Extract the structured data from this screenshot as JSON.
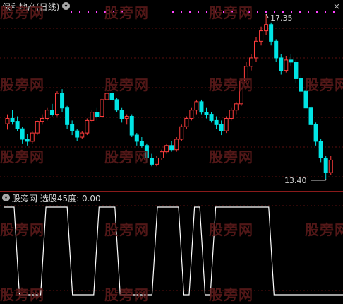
{
  "top": {
    "title": "保利地产(日线)",
    "high_label": "17.35",
    "low_label": "13.40",
    "close_symbol": "×"
  },
  "bottom": {
    "title": "股旁网  选股45度: 0.00"
  },
  "watermark": "股旁网",
  "icons": {
    "chevron": "chevron-down-icon"
  },
  "colors": {
    "up": "#ff3c3c",
    "down": "#00e5e5",
    "grid": "#5b0f0f",
    "line": "#ffffff",
    "dots": "#ff44ff"
  },
  "chart_data": [
    {
      "type": "candlestick",
      "title": "保利地产(日线)",
      "annotations": [
        "17.35",
        "13.40"
      ],
      "candles": [
        [
          14.72,
          14.95,
          14.58,
          14.85
        ],
        [
          14.85,
          15.05,
          14.7,
          14.78
        ],
        [
          14.78,
          14.9,
          14.55,
          14.6
        ],
        [
          14.6,
          14.65,
          14.25,
          14.35
        ],
        [
          14.35,
          14.48,
          14.2,
          14.3
        ],
        [
          14.3,
          14.55,
          14.25,
          14.5
        ],
        [
          14.5,
          14.8,
          14.45,
          14.78
        ],
        [
          14.78,
          14.95,
          14.7,
          14.85
        ],
        [
          14.85,
          15.1,
          14.8,
          15.05
        ],
        [
          15.05,
          15.2,
          14.9,
          14.95
        ],
        [
          14.95,
          15.5,
          14.9,
          15.45
        ],
        [
          15.45,
          15.55,
          15.0,
          15.1
        ],
        [
          15.1,
          15.15,
          14.6,
          14.7
        ],
        [
          14.7,
          14.8,
          14.45,
          14.55
        ],
        [
          14.55,
          14.6,
          14.3,
          14.4
        ],
        [
          14.4,
          14.55,
          14.35,
          14.5
        ],
        [
          14.5,
          14.85,
          14.45,
          14.8
        ],
        [
          14.8,
          15.05,
          14.75,
          15.0
        ],
        [
          15.0,
          15.1,
          14.8,
          14.9
        ],
        [
          14.9,
          15.35,
          14.85,
          15.3
        ],
        [
          15.3,
          15.5,
          15.2,
          15.45
        ],
        [
          15.45,
          15.5,
          15.25,
          15.3
        ],
        [
          15.3,
          15.35,
          15.0,
          15.05
        ],
        [
          15.05,
          15.1,
          14.75,
          14.85
        ],
        [
          14.85,
          14.95,
          14.7,
          14.9
        ],
        [
          14.9,
          14.95,
          14.4,
          14.45
        ],
        [
          14.45,
          14.5,
          14.2,
          14.3
        ],
        [
          14.3,
          14.4,
          14.15,
          14.2
        ],
        [
          14.2,
          14.25,
          13.8,
          13.9
        ],
        [
          13.9,
          14.0,
          13.7,
          13.75
        ],
        [
          13.75,
          13.95,
          13.7,
          13.9
        ],
        [
          13.9,
          14.1,
          13.85,
          14.05
        ],
        [
          14.05,
          14.25,
          14.0,
          14.2
        ],
        [
          14.2,
          14.3,
          14.05,
          14.1
        ],
        [
          14.1,
          14.4,
          14.05,
          14.35
        ],
        [
          14.35,
          14.7,
          14.3,
          14.65
        ],
        [
          14.65,
          14.9,
          14.6,
          14.85
        ],
        [
          14.85,
          15.1,
          14.8,
          15.05
        ],
        [
          15.05,
          15.3,
          14.95,
          15.25
        ],
        [
          15.25,
          15.3,
          14.95,
          15.0
        ],
        [
          15.0,
          15.1,
          14.85,
          14.95
        ],
        [
          14.95,
          15.0,
          14.75,
          14.8
        ],
        [
          14.8,
          14.9,
          14.6,
          14.7
        ],
        [
          14.7,
          14.8,
          14.45,
          14.55
        ],
        [
          14.55,
          14.9,
          14.5,
          14.85
        ],
        [
          14.85,
          15.1,
          14.8,
          15.05
        ],
        [
          15.05,
          15.25,
          14.95,
          15.2
        ],
        [
          15.2,
          15.8,
          15.15,
          15.75
        ],
        [
          15.75,
          16.2,
          15.7,
          16.1
        ],
        [
          16.1,
          16.4,
          16.0,
          16.3
        ],
        [
          16.3,
          16.8,
          16.2,
          16.7
        ],
        [
          16.7,
          17.05,
          16.6,
          16.95
        ],
        [
          16.95,
          17.35,
          16.85,
          17.1
        ],
        [
          17.1,
          17.15,
          16.6,
          16.7
        ],
        [
          16.7,
          16.75,
          16.2,
          16.3
        ],
        [
          16.3,
          16.4,
          15.9,
          16.0
        ],
        [
          16.0,
          16.35,
          15.95,
          16.25
        ],
        [
          16.25,
          16.4,
          16.1,
          16.2
        ],
        [
          16.2,
          16.25,
          15.7,
          15.8
        ],
        [
          15.8,
          15.9,
          15.4,
          15.5
        ],
        [
          15.5,
          15.55,
          15.0,
          15.1
        ],
        [
          15.1,
          15.15,
          14.6,
          14.7
        ],
        [
          14.7,
          14.75,
          14.2,
          14.3
        ],
        [
          14.3,
          14.35,
          13.8,
          13.9
        ],
        [
          13.9,
          13.95,
          13.4,
          13.55
        ],
        [
          13.55,
          13.95,
          13.5,
          13.85
        ]
      ]
    },
    {
      "type": "line",
      "title": "选股45度",
      "series": [
        {
          "name": "选股45度",
          "values": [
            1,
            1,
            1,
            0,
            0,
            0,
            0,
            0,
            1,
            1,
            1,
            1,
            1,
            0,
            0,
            0,
            0,
            0,
            1,
            1,
            1,
            1,
            0,
            0,
            0,
            0,
            0,
            0,
            0,
            1,
            1,
            1,
            1,
            1,
            0,
            0,
            1,
            1,
            0,
            0,
            1,
            1,
            1,
            1,
            1,
            1,
            1,
            1,
            1,
            1,
            1,
            0,
            0,
            0,
            0,
            0,
            0,
            0,
            0,
            0,
            0,
            0,
            0,
            0,
            0
          ]
        }
      ],
      "ylim": [
        0,
        1
      ]
    }
  ]
}
